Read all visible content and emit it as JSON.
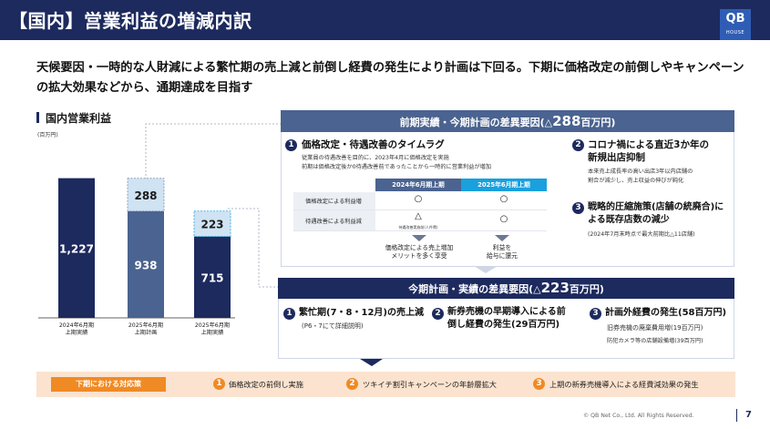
{
  "header": {
    "title": "【国内】営業利益の増減内訳"
  },
  "logo": {
    "main": "QB",
    "sub": "HOUSE"
  },
  "lead": "天候要因・一時的な人財減による繁忙期の売上減と前倒し経費の発生により計画は下回る。下期に価格改定の前倒しやキャンペーンの拡大効果などから、通期達成を目指す",
  "section_title": "国内営業利益",
  "unit": "(百万円)",
  "colors": {
    "navy": "#1d2a5e",
    "mid_blue": "#4a6390",
    "light_blue": "#cfe3f3",
    "cyan": "#1aa0dc",
    "orange": "#f08a24"
  },
  "chart_data": {
    "type": "bar",
    "ylabel": "(百万円)",
    "categories": [
      "2024年6月期\n上期実績",
      "2025年6月期\n上期計画",
      "2025年6月期\n上期実績"
    ],
    "stacked_base": [
      1227,
      938,
      715
    ],
    "stacked_top": [
      0,
      288,
      223
    ],
    "ylim": [
      0,
      1300
    ],
    "grid": false,
    "labels": {
      "cat0_line1": "2024年6月期",
      "cat0_line2": "上期実績",
      "cat1_line1": "2025年6月期",
      "cat1_line2": "上期計画",
      "cat2_line1": "2025年6月期",
      "cat2_line2": "上期実績"
    }
  },
  "box1": {
    "head_prefix": "前期実績・今期計画の差異要因(△",
    "head_value": "288",
    "head_suffix": "百万円)",
    "item1": {
      "num": "1",
      "title": "価格改定・待遇改善のタイムラグ",
      "sub1": "従業員の待遇改善を目的に、2023年4月に価格改定を実施",
      "sub2": "前期は価格改定後か0待遇改善前であったことから一時的に営業利益が増加",
      "col1": "2024年6月期上期",
      "col2": "2025年6月期上期",
      "row1": "価格改定による利益増",
      "row2": "待遇改善による利益減",
      "row1_c1": "○",
      "row1_c2": "○",
      "row2_c1": "△",
      "row2_c1_sub": "待遇改善実施前(人件費)",
      "row2_c2": "○",
      "note1_l1": "価格改定による売上増加",
      "note1_l2": "メリットを多く享受",
      "note2_l1": "利益を",
      "note2_l2": "給与に還元"
    },
    "item2": {
      "num": "2",
      "title_l1": "コロナ禍による直近3か年の",
      "title_l2": "新規出店抑制",
      "sub1": "本来売上成長率の高い出店3年以内店舗の",
      "sub2": "割合が減少し、売上収益の伸びが鈍化"
    },
    "item3": {
      "num": "3",
      "title_l1": "戦略的圧縮施策(店舗の統廃合)に",
      "title_l2": "よる既存店数の減少",
      "sub1": "(2024年7月末時点で最大前期比△11店舗)"
    }
  },
  "box2": {
    "head_prefix": "今期計画・実績の差異要因(△",
    "head_value": "223",
    "head_suffix": "百万円)",
    "item1": {
      "num": "1",
      "title": "繁忙期(7・8・12月)の売上減",
      "sub": "(P6・7にて詳細説明)"
    },
    "item2": {
      "num": "2",
      "title_l1": "新券売機の早期導入による前",
      "title_l2": "倒し経費の発生(29百万円)"
    },
    "item3": {
      "num": "3",
      "title": "計画外経費の発生(58百万円)",
      "sub1": "旧券売機の廃棄費用増(19百万円)",
      "sub2": "防犯カメラ等の店舗設備増(39百万円)"
    }
  },
  "bottom": {
    "label": "下期における対応策",
    "items": [
      {
        "num": "1",
        "text": "価格改定の前倒し実施"
      },
      {
        "num": "2",
        "text": "ツキイチ割引キャンペーンの年齢層拡大"
      },
      {
        "num": "3",
        "text": "上期の新券売機導入による経費減効果の発生"
      }
    ]
  },
  "footer": {
    "copyright": "© QB Net Co., Ltd. All Rights Reserved.",
    "page": "7"
  }
}
